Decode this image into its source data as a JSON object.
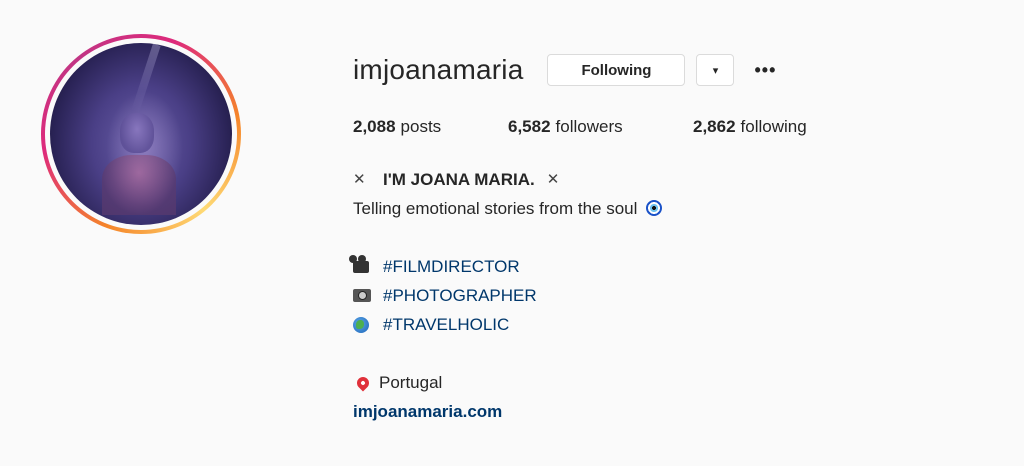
{
  "profile": {
    "username": "imjoanamaria",
    "following_button_label": "Following",
    "dropdown_glyph": "▾",
    "more_glyph": "•••"
  },
  "stats": {
    "posts_count": "2,088",
    "posts_label": "posts",
    "followers_count": "6,582",
    "followers_label": "followers",
    "following_count": "2,862",
    "following_label": "following"
  },
  "bio": {
    "x_mark": "✕",
    "display_name": "I'M JOANA MARIA.",
    "tagline": "Telling emotional stories from the soul",
    "hashtags": [
      {
        "icon": "movie-camera-icon",
        "text": "#FILMDIRECTOR"
      },
      {
        "icon": "camera-icon",
        "text": "#PHOTOGRAPHER"
      },
      {
        "icon": "globe-icon",
        "text": "#TRAVELHOLIC"
      }
    ],
    "location": "Portugal",
    "website": "imjoanamaria.com"
  },
  "colors": {
    "link": "#00376b",
    "background": "#fafafa",
    "text": "#262626"
  }
}
